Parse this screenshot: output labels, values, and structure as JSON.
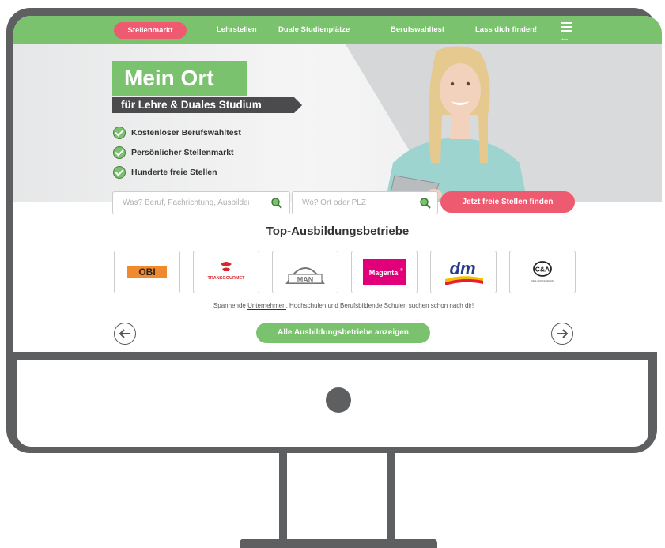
{
  "nav": {
    "items": [
      "Stellenmarkt",
      "Lehrstellen",
      "Duale Studienplätze",
      "Berufswahltest",
      "Lass dich finden!"
    ],
    "menu_label": "Mehr"
  },
  "hero": {
    "title": "Mein Ort",
    "subtitle": "für Lehre & Duales Studium",
    "features": [
      {
        "prefix": "Kostenloser ",
        "link": "Berufswahltest"
      },
      {
        "prefix": "Persönlicher Stellenmarkt",
        "link": ""
      },
      {
        "prefix": "Hunderte freie Stellen",
        "link": ""
      }
    ]
  },
  "search": {
    "what_placeholder": "Was? Beruf, Fachrichtung, Ausbilder",
    "where_placeholder": "Wo? Ort oder PLZ",
    "cta": "Jetzt freie Stellen finden"
  },
  "companies": {
    "title": "Top-Ausbildungsbetriebe",
    "logos": [
      "OBI",
      "TRANSGOURMET",
      "MAN",
      "Magenta",
      "dm",
      "C&A"
    ],
    "desc_before": "Spannende ",
    "desc_link": "Unternehmen",
    "desc_after": ", Hochschulen und Berufsbildende Schulen suchen schon nach dir!",
    "all_button": "Alle Ausbildungsbetriebe anzeigen",
    "ca_tagline": "FEEL GOOD FASHION"
  },
  "colors": {
    "green": "#7ac26e",
    "pink": "#ee5a6f",
    "dark": "#4b4b4d",
    "frame": "#5e5f61"
  }
}
